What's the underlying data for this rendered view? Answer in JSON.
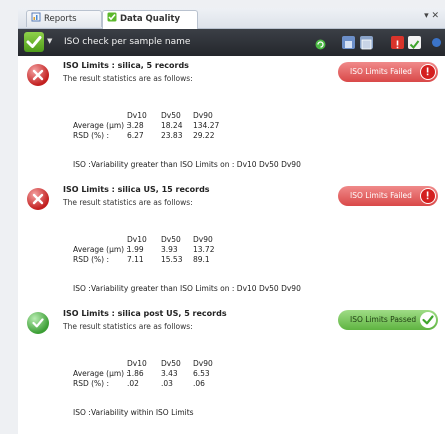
{
  "tabs": [
    {
      "label": "Reports",
      "active": false
    },
    {
      "label": "Data Quality",
      "active": true
    }
  ],
  "tab_controls": "▾ ✕",
  "toolbar": {
    "title": "ISO check per sample name"
  },
  "colors": {
    "fail": "#d94848",
    "pass": "#5fb441",
    "toolbar": "#2a2d33"
  },
  "entries": [
    {
      "title": "ISO Limits : silica,  5 records",
      "subtitle": "The result statistics are as follows:",
      "status": "ISO Limits Failed",
      "status_type": "fail",
      "columns": [
        "Dv10",
        "Dv50",
        "Dv90"
      ],
      "rows": [
        {
          "label": "Average (µm) :",
          "values": [
            "3.28",
            "18.24",
            "134.27"
          ]
        },
        {
          "label": "RSD (%)      :",
          "values": [
            "6.27",
            "23.83",
            "29.22"
          ]
        }
      ],
      "note_prefix": "ISO :",
      "note": "Variability greater than ISO Limits on : Dv10  Dv50 Dv90"
    },
    {
      "title": "ISO Limits : silica US,  15 records",
      "subtitle": "The result statistics are as follows:",
      "status": "ISO Limits Failed",
      "status_type": "fail",
      "columns": [
        "Dv10",
        "Dv50",
        "Dv90"
      ],
      "rows": [
        {
          "label": "Average (µm) :",
          "values": [
            "1.99",
            "3.93",
            "13.72"
          ]
        },
        {
          "label": "RSD (%)      :",
          "values": [
            "7.11",
            "15.53",
            "89.1"
          ]
        }
      ],
      "note_prefix": "ISO :",
      "note": "Variability greater than ISO Limits on :  Dv10  Dv50 Dv90"
    },
    {
      "title": "ISO Limits : silica post US,  5 records",
      "subtitle": "The result statistics are as follows:",
      "status": "ISO Limits Passed",
      "status_type": "pass",
      "columns": [
        "Dv10",
        "Dv50",
        "Dv90"
      ],
      "rows": [
        {
          "label": "Average (µm) :",
          "values": [
            "1.86",
            "3.43",
            "6.53"
          ]
        },
        {
          "label": "RSD (%)      :",
          "values": [
            ".02",
            ".03",
            ".06"
          ]
        }
      ],
      "note_prefix": "ISO :",
      "note": "Variability within ISO Limits"
    }
  ]
}
